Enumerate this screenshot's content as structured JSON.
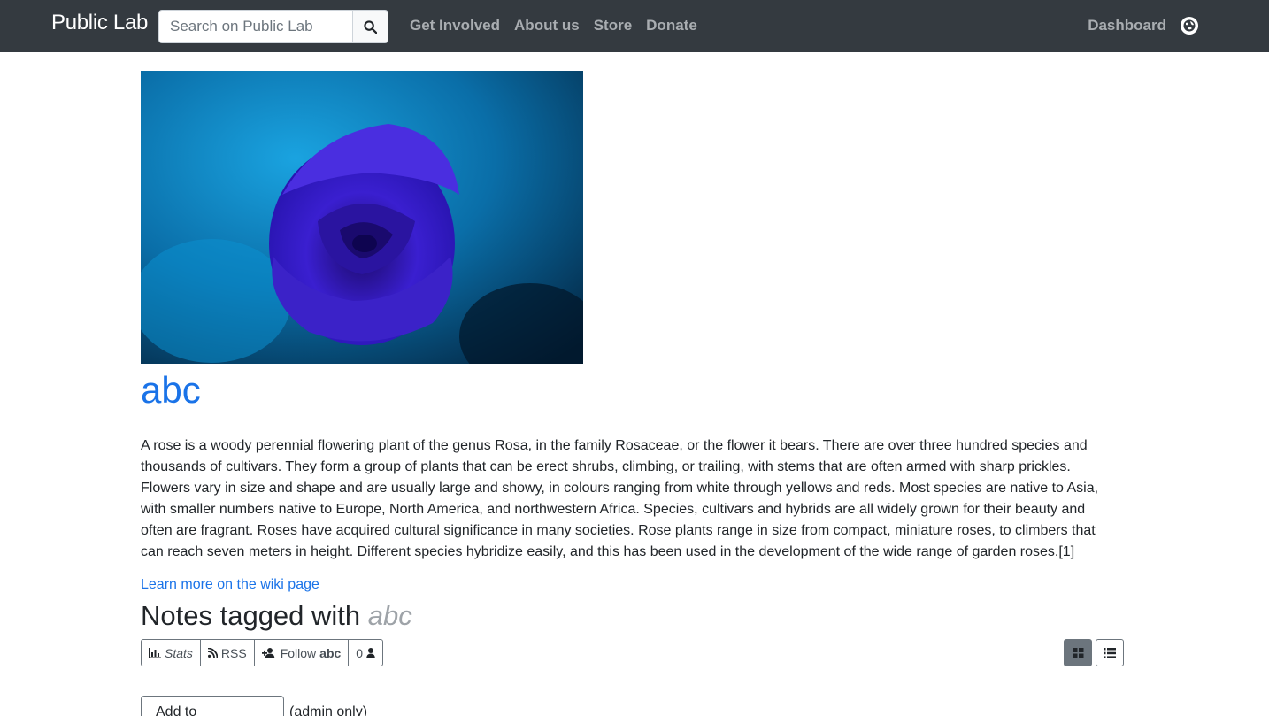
{
  "navbar": {
    "brand": "Public Lab",
    "search_placeholder": "Search on Public Lab",
    "links": [
      "Get Involved",
      "About us",
      "Store",
      "Donate"
    ],
    "dashboard": "Dashboard"
  },
  "page": {
    "title": "abc",
    "description": "A rose is a woody perennial flowering plant of the genus Rosa, in the family Rosaceae, or the flower it bears. There are over three hundred species and thousands of cultivars. They form a group of plants that can be erect shrubs, climbing, or trailing, with stems that are often armed with sharp prickles. Flowers vary in size and shape and are usually large and showy, in colours ranging from white through yellows and reds. Most species are native to Asia, with smaller numbers native to Europe, North America, and northwestern Africa. Species, cultivars and hybrids are all widely grown for their beauty and often are fragrant. Roses have acquired cultural significance in many societies. Rose plants range in size from compact, miniature roses, to climbers that can reach seven meters in height. Different species hybridize easily, and this has been used in the development of the wide range of garden roses.[1]",
    "wiki_link": "Learn more on the wiki page",
    "notes_heading": "Notes tagged with",
    "notes_tag": "abc"
  },
  "actions": {
    "stats": "Stats",
    "rss": "RSS",
    "follow": "Follow",
    "follow_tag": "abc",
    "followers": "0"
  },
  "bottom": {
    "select_label": "Add to",
    "extra": "(admin only)"
  },
  "colors": {
    "navbar_bg": "#343a40",
    "link": "#1a73e8"
  }
}
